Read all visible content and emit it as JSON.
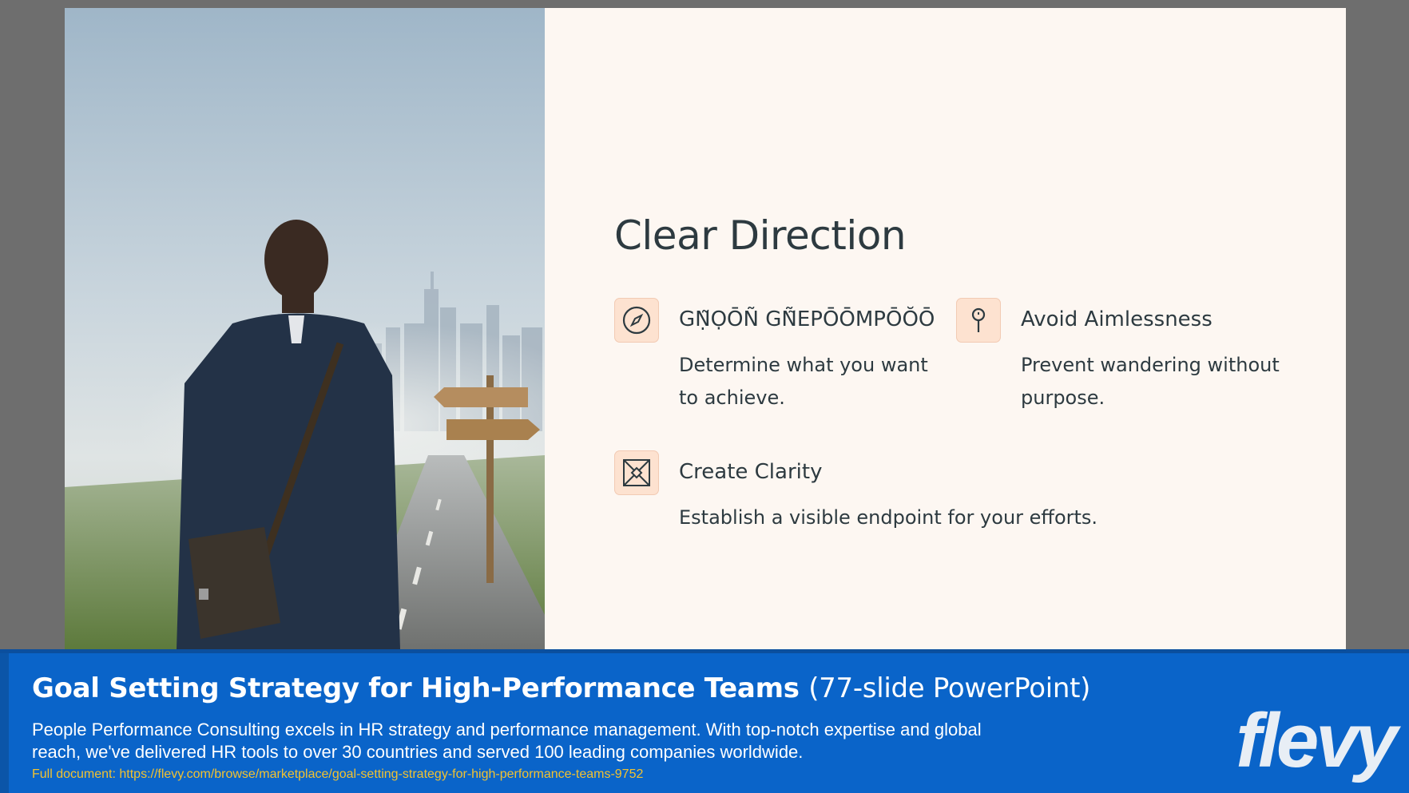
{
  "slide": {
    "title": "Clear Direction",
    "features": [
      {
        "icon": "compass-icon",
        "title": "GṆ̃ỌŌÑ GÑ̃EPŌŌMPŌŎŌ",
        "description": "Determine what you want to achieve."
      },
      {
        "icon": "signpost-icon",
        "title": "Avoid Aimlessness",
        "description": "Prevent wandering without purpose."
      },
      {
        "icon": "target-arrows-icon",
        "title": "Create Clarity",
        "description": "Establish a visible endpoint for your efforts."
      }
    ],
    "colors": {
      "background": "#fdf7f2",
      "text": "#2d3a40",
      "icon_bg": "#fde2d0"
    }
  },
  "banner": {
    "title": "Goal Setting Strategy for High-Performance Teams",
    "title_suffix": "(77-slide PowerPoint)",
    "description": "People Performance Consulting excels in HR strategy and performance management. With top-notch expertise and global reach, we've delivered HR tools to over 30 countries and served 100 leading companies worldwide.",
    "link": "Full document: https://flevy.com/browse/marketplace/goal-setting-strategy-for-high-performance-teams-9752",
    "brand": "flevy",
    "colors": {
      "background": "#0a64c9",
      "link": "#f2c230"
    }
  }
}
